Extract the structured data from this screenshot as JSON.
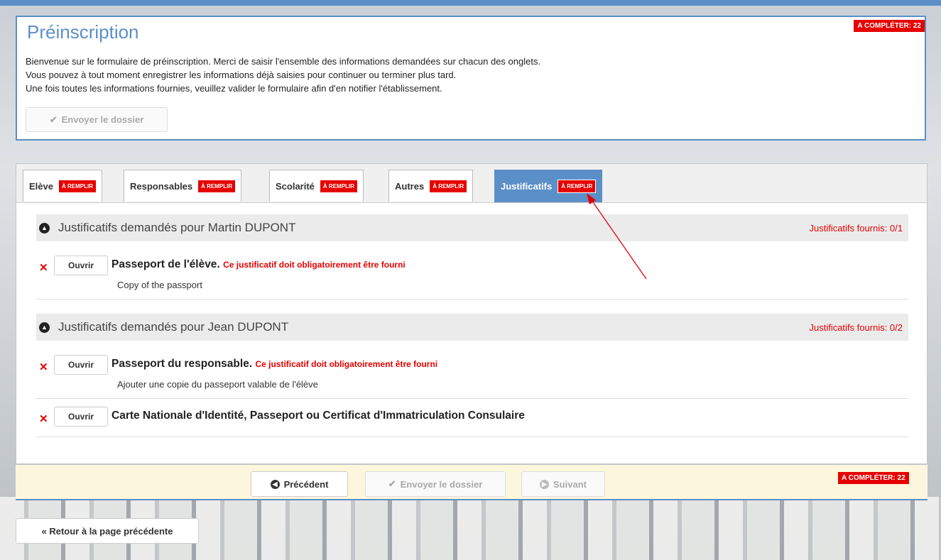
{
  "header": {
    "title": "Préinscription",
    "badge": "A COMPLÉTER: 22",
    "intro": [
      "Bienvenue sur le formulaire de préinscription. Merci de saisir l'ensemble des informations demandées sur chacun des onglets.",
      "Vous pouvez à tout moment enregistrer les informations déjà saisies pour continuer ou terminer plus tard.",
      "Une fois toutes les informations fournies, veuillez valider le formulaire afin d'en notifier l'établissement."
    ],
    "send_button": "Envoyer le dossier"
  },
  "tabs": [
    {
      "label": "Elève",
      "badge": "À REMPLIR",
      "active": false
    },
    {
      "label": "Responsables",
      "badge": "À REMPLIR",
      "active": false
    },
    {
      "label": "Scolarité",
      "badge": "À REMPLIR",
      "active": false
    },
    {
      "label": "Autres",
      "badge": "À REMPLIR",
      "active": false
    },
    {
      "label": "Justificatifs",
      "badge": "À REMPLIR",
      "active": true
    }
  ],
  "sections": [
    {
      "title": "Justificatifs demandés pour Martin DUPONT",
      "count": "Justificatifs fournis: 0/1",
      "documents": [
        {
          "open_label": "Ouvrir",
          "name": "Passeport de l'élève",
          "warning": "Ce justificatif doit obligatoirement être fourni",
          "description": "Copy of the passport"
        }
      ]
    },
    {
      "title": "Justificatifs demandés pour Jean DUPONT",
      "count": "Justificatifs fournis: 0/2",
      "documents": [
        {
          "open_label": "Ouvrir",
          "name": "Passeport du responsable",
          "warning": "Ce justificatif doit obligatoirement être fourni",
          "description": "Ajouter une copie du passeport valable de l'élève"
        },
        {
          "open_label": "Ouvrir",
          "name": "Carte Nationale d'Identité, Passeport ou Certificat d'Immatriculation Consulaire",
          "warning": "",
          "description": ""
        }
      ]
    }
  ],
  "footer": {
    "prev_label": "Précédent",
    "send_label": "Envoyer le dossier",
    "next_label": "Suivant",
    "badge": "A COMPLÉTER: 22"
  },
  "back_label": "« Retour à la page précédente",
  "colors": {
    "accent": "#5b8fc7",
    "required": "#e60000",
    "footer_bg": "#fcf6dc"
  }
}
